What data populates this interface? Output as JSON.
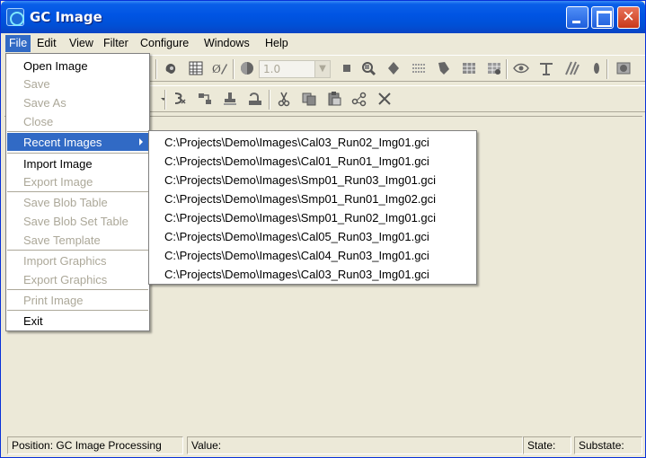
{
  "window": {
    "title": "GC Image"
  },
  "menubar": {
    "items": [
      {
        "label": "File",
        "active": true
      },
      {
        "label": "Edit"
      },
      {
        "label": "View"
      },
      {
        "label": "Filter"
      },
      {
        "label": "Configure"
      },
      {
        "label": "Windows"
      },
      {
        "label": "Help"
      }
    ]
  },
  "toolbar": {
    "zoom_value": "1.0"
  },
  "file_menu": {
    "items": [
      {
        "label": "Open Image",
        "enabled": true
      },
      {
        "label": "Save",
        "enabled": false
      },
      {
        "label": "Save As",
        "enabled": false
      },
      {
        "label": "Close",
        "enabled": false
      },
      {
        "label": "Recent Images",
        "enabled": true,
        "submenu": true,
        "highlighted": true
      },
      {
        "label": "Import Image",
        "enabled": true
      },
      {
        "label": "Export Image",
        "enabled": false
      },
      {
        "label": "Save Blob Table",
        "enabled": false
      },
      {
        "label": "Save Blob Set Table",
        "enabled": false
      },
      {
        "label": "Save Template",
        "enabled": false
      },
      {
        "label": "Import Graphics",
        "enabled": false
      },
      {
        "label": "Export Graphics",
        "enabled": false
      },
      {
        "label": "Print Image",
        "enabled": false
      },
      {
        "label": "Exit",
        "enabled": true
      }
    ]
  },
  "recent_menu": {
    "items": [
      "C:\\Projects\\Demo\\Images\\Cal03_Run02_Img01.gci",
      "C:\\Projects\\Demo\\Images\\Cal01_Run01_Img01.gci",
      "C:\\Projects\\Demo\\Images\\Smp01_Run03_Img01.gci",
      "C:\\Projects\\Demo\\Images\\Smp01_Run01_Img02.gci",
      "C:\\Projects\\Demo\\Images\\Smp01_Run02_Img01.gci",
      "C:\\Projects\\Demo\\Images\\Cal05_Run03_Img01.gci",
      "C:\\Projects\\Demo\\Images\\Cal04_Run03_Img01.gci",
      "C:\\Projects\\Demo\\Images\\Cal03_Run03_Img01.gci"
    ]
  },
  "statusbar": {
    "position": "Position: GC Image Processing",
    "value": "Value:",
    "state": "State:",
    "substate": "Substate:"
  },
  "colors": {
    "title_bar": "#0054e3",
    "menu_highlight": "#316ac5",
    "face": "#ece9d8",
    "disabled_text": "#aca899"
  }
}
